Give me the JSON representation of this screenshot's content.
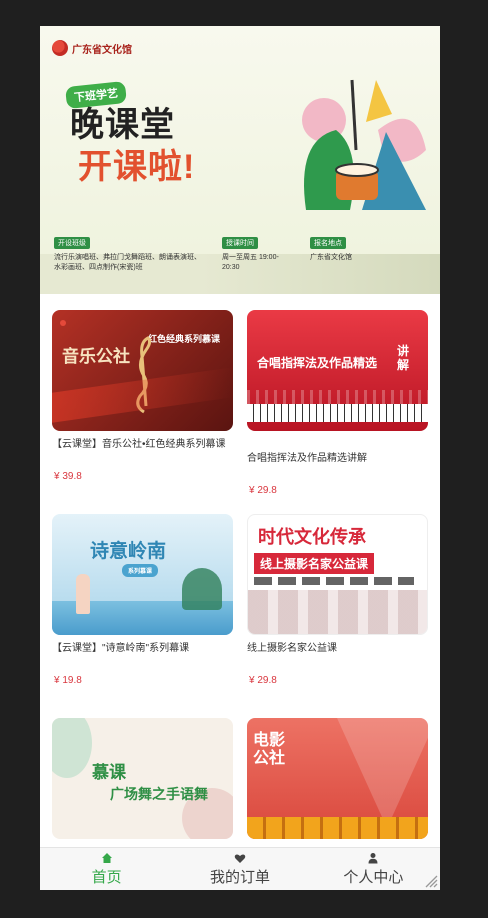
{
  "banner": {
    "logo_text": "广东省文化馆",
    "badge": "下班学艺",
    "title_line1": "晚课堂",
    "title_line2": "开课啦!",
    "info": [
      {
        "tag": "开设班级",
        "text": "流行乐演唱班、弗拉门戈舞蹈班、朗诵表演班、水彩画班、四点制作(宋瓷)班"
      },
      {
        "tag": "授课时间",
        "text": "周一至周五 19:00-20:30"
      },
      {
        "tag": "报名地点",
        "text": "广东省文化馆"
      }
    ]
  },
  "products": [
    {
      "title": "【云课堂】音乐公社•红色经典系列幕课",
      "price": "¥ 39.8",
      "thumb_text": "音乐公社",
      "thumb_sub": "红色经典系列慕课",
      "colors": [
        "#b43125",
        "#5a1410"
      ]
    },
    {
      "title": "合唱指挥法及作品精选讲解",
      "price": "¥ 29.8",
      "thumb_text": "合唱指挥法及作品精选",
      "thumb_sub": "讲解",
      "colors": [
        "#e8313e",
        "#b81423"
      ]
    },
    {
      "title": "【云课堂】\"诗意岭南\"系列幕课",
      "price": "¥ 19.8",
      "thumb_text": "诗意岭南",
      "thumb_sub": "系列慕课",
      "colors": [
        "#d6ecf6",
        "#9fcde6"
      ]
    },
    {
      "title": "线上摄影名家公益课",
      "price": "¥ 29.8",
      "thumb_text": "时代文化传承",
      "thumb_sub": "线上摄影名家公益课",
      "colors": [
        "#ffffff",
        "#f3e7e7"
      ]
    },
    {
      "title": "",
      "price": "",
      "thumb_text": "慕课",
      "thumb_sub": "广场舞之手语舞",
      "colors": [
        "#f7f1ea",
        "#eadfd2"
      ]
    },
    {
      "title": "",
      "price": "",
      "thumb_text": "电影公社",
      "thumb_sub": "",
      "colors": [
        "#ea6b5d",
        "#d9473c"
      ]
    }
  ],
  "tabbar": {
    "items": [
      {
        "label": "首页",
        "icon": "home-icon"
      },
      {
        "label": "我的订单",
        "icon": "heart-icon"
      },
      {
        "label": "个人中心",
        "icon": "user-icon"
      }
    ],
    "active_color": "#35a84a"
  }
}
